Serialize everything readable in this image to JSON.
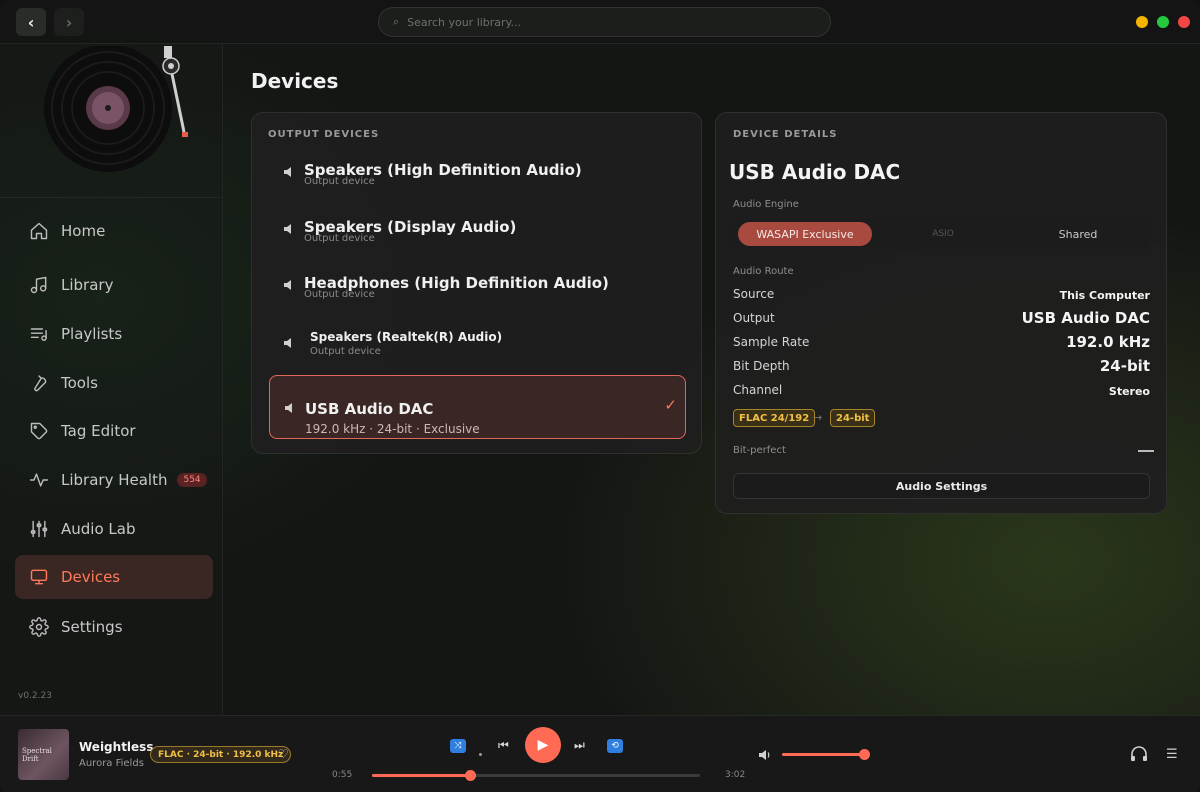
{
  "topbar": {
    "back_label": "‹",
    "forward_label": "›",
    "search_placeholder": "Search your library..."
  },
  "sidebar": {
    "items": [
      {
        "label": "Home",
        "icon": "home-icon"
      },
      {
        "label": "Library",
        "icon": "music-note-icon"
      },
      {
        "label": "Playlists",
        "icon": "playlist-icon"
      },
      {
        "label": "Tools",
        "icon": "wrench-icon"
      },
      {
        "label": "Tag Editor",
        "icon": "tag-icon"
      },
      {
        "label": "Library Health",
        "icon": "pulse-icon",
        "badge": "554"
      },
      {
        "label": "Audio Lab",
        "icon": "sliders-icon"
      },
      {
        "label": "Devices",
        "icon": "monitor-icon",
        "active": true
      },
      {
        "label": "Settings",
        "icon": "gear-icon"
      }
    ],
    "version": "v0.2.23"
  },
  "main": {
    "title": "Devices",
    "output_devices": {
      "label": "OUTPUT DEVICES",
      "items": [
        {
          "name": "Speakers (High Definition Audio)",
          "sub": "Output device"
        },
        {
          "name": "Speakers (Display Audio)",
          "sub": "Output device"
        },
        {
          "name": "Headphones (High Definition Audio)",
          "sub": "Output device"
        },
        {
          "name": "Speakers (Realtek(R) Audio)",
          "sub": "Output device"
        },
        {
          "name": "USB Audio DAC",
          "sub": "192.0 kHz · 24-bit · Exclusive",
          "selected": true
        }
      ]
    },
    "device_details": {
      "label": "DEVICE DETAILS",
      "title": "USB Audio DAC",
      "audio_engine_label": "Audio Engine",
      "engine_options": [
        "WASAPI Exclusive",
        "ASIO",
        "Shared"
      ],
      "engine_selected": "WASAPI Exclusive",
      "audio_route_label": "Audio Route",
      "route": [
        {
          "key": "Source",
          "value": "This Computer"
        },
        {
          "key": "Output",
          "value": "USB Audio DAC"
        },
        {
          "key": "Sample Rate",
          "value": "192.0 kHz"
        },
        {
          "key": "Bit Depth",
          "value": "24-bit"
        },
        {
          "key": "Channel",
          "value": "Stereo"
        }
      ],
      "format_in": "FLAC 24/192",
      "arrow": "→",
      "format_out": "24-bit",
      "bit_perfect_label": "Bit-perfect",
      "audio_settings_label": "Audio Settings"
    }
  },
  "player": {
    "album_art_text": "Spectral Drift",
    "title": "Weightless",
    "artist": "Aurora Fields",
    "quality": "FLAC · 24-bit · 192.0 kHz",
    "elapsed": "0:55",
    "duration": "3:02",
    "progress": 0.3,
    "volume": 1.0
  },
  "colors": {
    "accent": "#ff6a55",
    "active_bg": "#3a2622",
    "gold": "#f0c045",
    "blue": "#2f7fe0"
  }
}
